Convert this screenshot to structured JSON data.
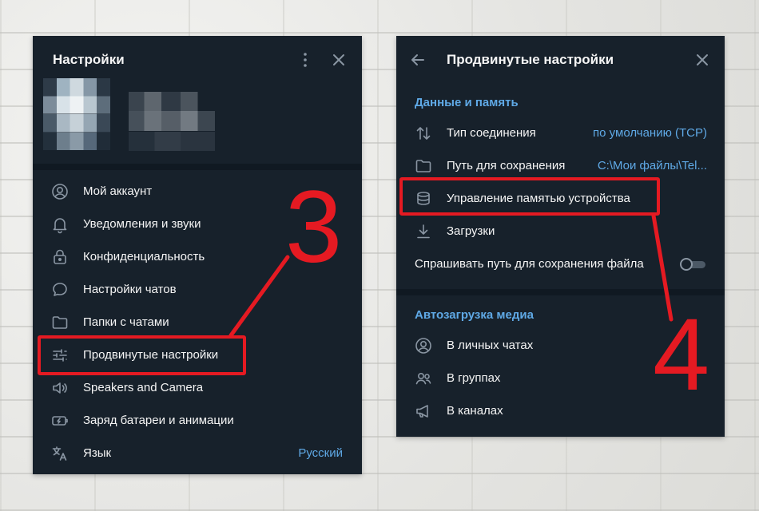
{
  "left_panel": {
    "title": "Настройки",
    "header_icons": [
      "more-vertical-icon",
      "close-icon"
    ],
    "items": [
      {
        "icon": "account-circle-icon",
        "label": "Мой аккаунт",
        "value": ""
      },
      {
        "icon": "bell-icon",
        "label": "Уведомления и звуки",
        "value": ""
      },
      {
        "icon": "lock-icon",
        "label": "Конфиденциальность",
        "value": ""
      },
      {
        "icon": "chat-bubble-icon",
        "label": "Настройки чатов",
        "value": ""
      },
      {
        "icon": "folder-icon",
        "label": "Папки с чатами",
        "value": ""
      },
      {
        "icon": "sliders-icon",
        "label": "Продвинутые настройки",
        "value": ""
      },
      {
        "icon": "speaker-icon",
        "label": "Speakers and Camera",
        "value": ""
      },
      {
        "icon": "battery-icon",
        "label": "Заряд батареи и анимации",
        "value": ""
      },
      {
        "icon": "translate-icon",
        "label": "Язык",
        "value": "Русский"
      }
    ]
  },
  "right_panel": {
    "title": "Продвинутые настройки",
    "header_icons": [
      "back-arrow-icon",
      "close-icon"
    ],
    "sections": [
      {
        "title": "Данные и память",
        "items": [
          {
            "icon": "swap-vertical-icon",
            "label": "Тип соединения",
            "value": "по умолчанию (TCP)"
          },
          {
            "icon": "folder-icon",
            "label": "Путь для сохранения",
            "value": "C:\\Мои файлы\\Tel..."
          },
          {
            "icon": "database-icon",
            "label": "Управление памятью устройства",
            "value": ""
          },
          {
            "icon": "download-icon",
            "label": "Загрузки",
            "value": ""
          }
        ],
        "toggle": {
          "label": "Спрашивать путь для сохранения файла",
          "on": false
        }
      },
      {
        "title": "Автозагрузка медиа",
        "items": [
          {
            "icon": "account-circle-icon",
            "label": "В личных чатах",
            "value": ""
          },
          {
            "icon": "group-icon",
            "label": "В группах",
            "value": ""
          },
          {
            "icon": "megaphone-icon",
            "label": "В каналах",
            "value": ""
          }
        ]
      }
    ]
  },
  "annotations": {
    "step_left": "3",
    "step_right": "4",
    "color": "#e51a22"
  },
  "colors": {
    "panel_bg": "#17212b",
    "accent": "#5fa9e6",
    "icon": "#8a96a3",
    "text": "#f5f5f5"
  }
}
